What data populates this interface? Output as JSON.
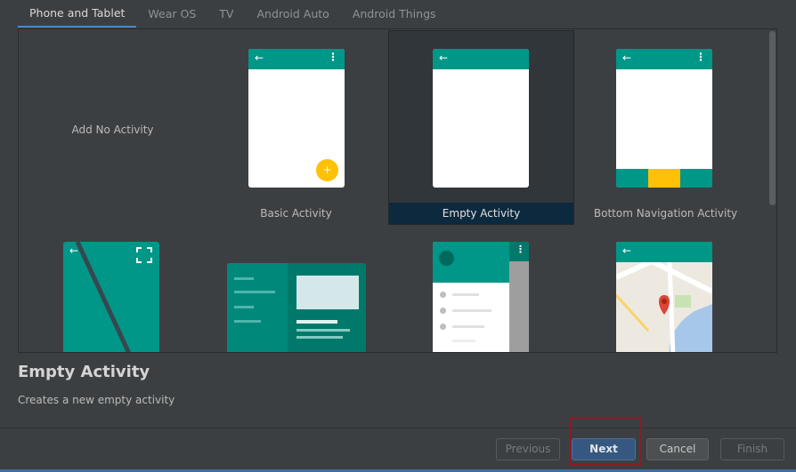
{
  "tabs": [
    {
      "label": "Phone and Tablet"
    },
    {
      "label": "Wear OS"
    },
    {
      "label": "TV"
    },
    {
      "label": "Android Auto"
    },
    {
      "label": "Android Things"
    }
  ],
  "templates": [
    {
      "label": "Add No Activity"
    },
    {
      "label": "Basic Activity"
    },
    {
      "label": "Empty Activity"
    },
    {
      "label": "Bottom Navigation Activity"
    }
  ],
  "icons": {
    "back": "←",
    "menu": "⋮",
    "fab": "+",
    "fullscreen": "⛶"
  },
  "detail": {
    "title": "Empty Activity",
    "description": "Creates a new empty activity"
  },
  "buttons": {
    "previous": "Previous",
    "next": "Next",
    "cancel": "Cancel",
    "finish": "Finish"
  },
  "colors": {
    "teal": "#009688",
    "amber": "#ffc107",
    "selection": "#0d293e",
    "primary_button": "#365880"
  }
}
